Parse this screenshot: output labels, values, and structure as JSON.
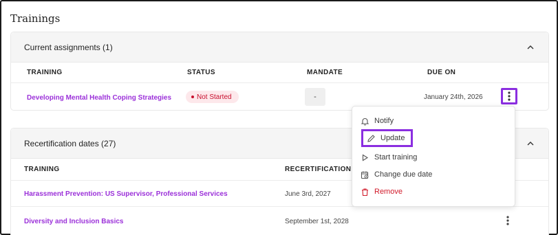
{
  "page": {
    "title": "Trainings"
  },
  "current": {
    "header": "Current assignments (1)",
    "columns": [
      "TRAINING",
      "STATUS",
      "MANDATE",
      "DUE ON"
    ],
    "rows": [
      {
        "training": "Developing Mental Health Coping Strategies",
        "status": "Not Started",
        "mandate": "-",
        "due_on": "January 24th, 2026"
      }
    ]
  },
  "recert": {
    "header": "Recertification dates (27)",
    "columns": [
      "TRAINING",
      "RECERTIFICATION D"
    ],
    "rows": [
      {
        "training": "Harassment Prevention: US Supervisor, Professional Services",
        "date": "June 3rd, 2027"
      },
      {
        "training": "Diversity and Inclusion Basics",
        "date": "September 1st, 2028"
      }
    ]
  },
  "menu": {
    "items": [
      {
        "label": "Notify",
        "icon": "bell-icon"
      },
      {
        "label": "Update",
        "icon": "pencil-icon"
      },
      {
        "label": "Start training",
        "icon": "play-icon"
      },
      {
        "label": "Change due date",
        "icon": "calendar-clock-icon"
      },
      {
        "label": "Remove",
        "icon": "trash-icon"
      }
    ]
  },
  "colors": {
    "accent": "#9b30d9",
    "highlight": "#8b2ee0",
    "danger": "#d11a2a",
    "badge_bg": "#fde8eb"
  }
}
